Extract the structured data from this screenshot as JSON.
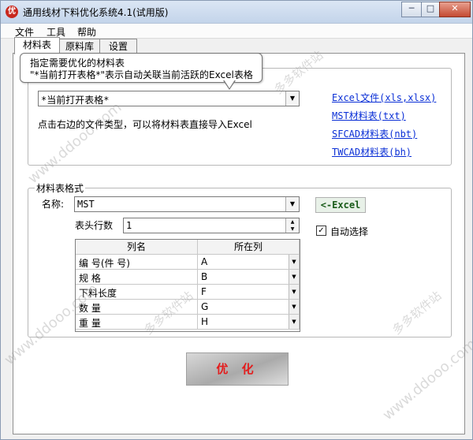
{
  "window": {
    "title": "通用线材下料优化系统4.1(试用版)",
    "app_icon_glyph": "优",
    "controls": {
      "minimize": "─",
      "maximize": "□",
      "close": "✕"
    }
  },
  "menu": {
    "items": [
      "文件",
      "工具",
      "帮助"
    ]
  },
  "tabs": [
    "材料表",
    "原料库",
    "设置"
  ],
  "tooltip": {
    "line1": "指定需要优化的材料表",
    "line2": "\"*当前打开表格*\"表示自动关联当前活跃的Excel表格"
  },
  "source": {
    "combo_value": "*当前打开表格*",
    "instruction": "点击右边的文件类型，可以将材料表直接导入Excel",
    "links": [
      "Excel文件(xls,xlsx)",
      "MST材料表(txt)",
      "SFCAD材料表(nbt)",
      "TWCAD材料表(bh)"
    ]
  },
  "format": {
    "group_title": "材料表格式",
    "name_label": "名称:",
    "name_value": "MST",
    "excel_button": "<-Excel",
    "header_rows_label": "表头行数",
    "header_rows_value": "1",
    "auto_select_label": "自动选择",
    "auto_select_checked": true,
    "table": {
      "headers": [
        "列名",
        "所在列"
      ],
      "rows": [
        {
          "name": "编 号(件 号)",
          "column": "A"
        },
        {
          "name": "规 格",
          "column": "B"
        },
        {
          "name": "下料长度",
          "column": "F"
        },
        {
          "name": "数 量",
          "column": "G"
        },
        {
          "name": "重 量",
          "column": "H"
        }
      ]
    }
  },
  "optimize_button": "优 化",
  "watermark": {
    "text": "多多软件站",
    "url": "www.ddooo.com"
  },
  "colors": {
    "link": "#0a2fd6",
    "optimize_text": "#e31d1d",
    "excel_button_text": "#1a5c1a"
  }
}
